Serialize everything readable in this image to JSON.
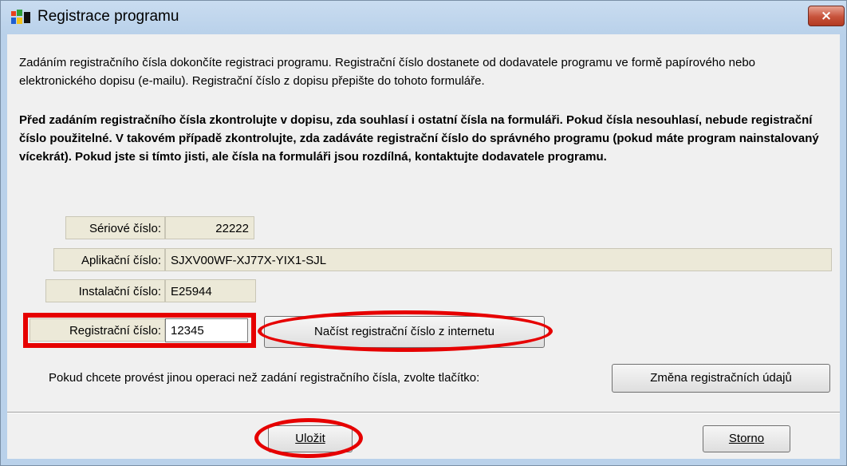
{
  "window": {
    "title": "Registrace programu",
    "close_label": "×"
  },
  "intro": {
    "paragraph1": "Zadáním registračního čísla dokončíte registraci programu. Registrační číslo dostanete od dodavatele programu ve formě papírového nebo elektronického dopisu (e-mailu). Registrační číslo z dopisu přepište do tohoto formuláře.",
    "paragraph2": "Před zadáním registračního čísla zkontrolujte v dopisu, zda souhlasí i ostatní čísla na formuláři. Pokud čísla nesouhlasí, nebude registrační číslo použitelné. V takovém případě zkontrolujte, zda zadáváte registrační číslo do správného programu (pokud máte program nainstalovaný vícekrát). Pokud jste si tímto jisti, ale čísla na formuláři jsou rozdílná, kontaktujte dodavatele programu."
  },
  "form": {
    "serial_label": "Sériové číslo:",
    "serial_value": "22222",
    "app_label": "Aplikační číslo:",
    "app_value": "SJXV00WF-XJ77X-YIX1-SJL",
    "install_label": "Instalační číslo:",
    "install_value": "E25944",
    "reg_label": "Registrační číslo:",
    "reg_value": "12345",
    "fetch_button": "Načíst registrační číslo z internetu"
  },
  "other": {
    "text": "Pokud chcete provést jinou operaci než zadání registračního čísla, zvolte tlačítko:",
    "change_button": "Změna registračních údajů"
  },
  "footer": {
    "save_button": "Uložit",
    "cancel_button": "Storno"
  },
  "colors": {
    "annotation": "#e60000",
    "title_bar": "#b9d1ea",
    "client": "#f0f0f0"
  }
}
